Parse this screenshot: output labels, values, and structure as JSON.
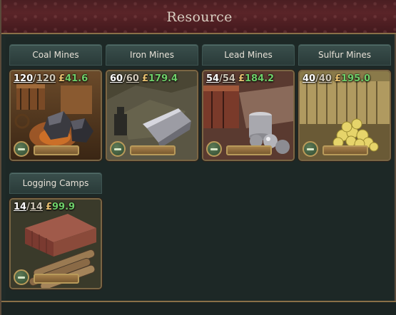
{
  "panel": {
    "title": "Resource"
  },
  "resources": [
    {
      "name": "Coal Mines",
      "used": "120",
      "capacity": "120",
      "currency_symbol": "£",
      "income": "41.6",
      "icon": "coal-icon"
    },
    {
      "name": "Iron Mines",
      "used": "60",
      "capacity": "60",
      "currency_symbol": "£",
      "income": "179.4",
      "icon": "iron-icon"
    },
    {
      "name": "Lead Mines",
      "used": "54",
      "capacity": "54",
      "currency_symbol": "£",
      "income": "184.2",
      "icon": "lead-icon"
    },
    {
      "name": "Sulfur Mines",
      "used": "40",
      "capacity": "40",
      "currency_symbol": "£",
      "income": "195.0",
      "icon": "sulfur-icon"
    },
    {
      "name": "Logging Camps",
      "used": "14",
      "capacity": "14",
      "currency_symbol": "£",
      "income": "99.9",
      "icon": "logs-icon"
    }
  ],
  "colors": {
    "header": "#5a2428",
    "income": "#6fd06a",
    "tab": "#2f4341",
    "border": "#7a6644"
  }
}
